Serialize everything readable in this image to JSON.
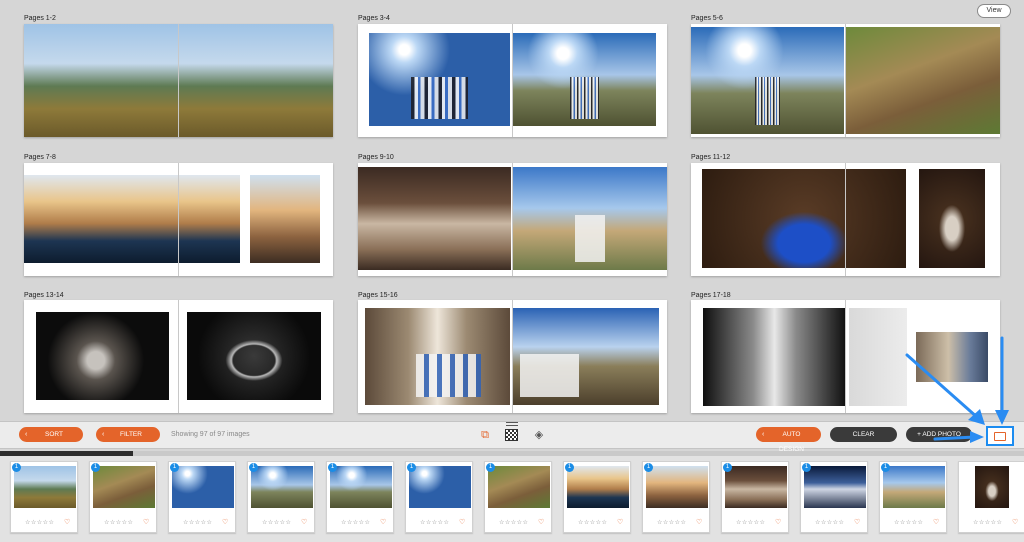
{
  "header": {
    "view_label": "View"
  },
  "spreads": [
    {
      "label": "Pages 1-2"
    },
    {
      "label": "Pages 3-4"
    },
    {
      "label": "Pages 5-6"
    },
    {
      "label": "Pages 7-8"
    },
    {
      "label": "Pages 9-10"
    },
    {
      "label": "Pages 11-12"
    },
    {
      "label": "Pages 13-14"
    },
    {
      "label": "Pages 15-16"
    },
    {
      "label": "Pages 17-18"
    }
  ],
  "toolbar": {
    "sort_label": "SORT",
    "filter_label": "FILTER",
    "showing_text": "Showing 97 of 97 images",
    "auto_design_label": "AUTO DESIGN",
    "clear_label": "CLEAR",
    "add_photos_label": "+ ADD PHOTO",
    "icons": [
      "layers-copy-icon",
      "checker-icon",
      "stack-icon",
      "fit-photo-icon"
    ]
  },
  "progress": {
    "fraction": 0.13
  },
  "filmstrip": {
    "stars_text": "☆☆☆☆☆",
    "heart": "♡",
    "badges": [
      "1",
      "1",
      "1",
      "1",
      "1",
      "1",
      "1",
      "1",
      "1",
      "1",
      "1",
      "1",
      "1"
    ]
  },
  "colors": {
    "accent": "#e4642a",
    "highlight": "#1c8cf0",
    "dark_button": "#3a3a3a"
  }
}
